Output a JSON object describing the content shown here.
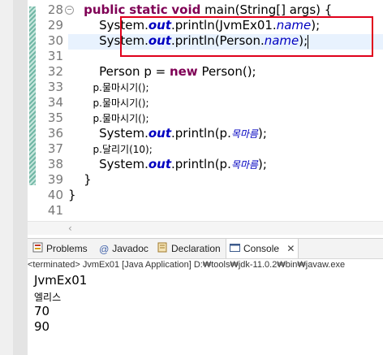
{
  "editor": {
    "lines": [
      {
        "num": "28",
        "parts": [
          {
            "t": "    "
          },
          {
            "t": "public",
            "c": "kw"
          },
          {
            "t": " "
          },
          {
            "t": "static",
            "c": "kw"
          },
          {
            "t": " "
          },
          {
            "t": "void",
            "c": "kw"
          },
          {
            "t": " main(String[] args) {"
          }
        ]
      },
      {
        "num": "29",
        "parts": [
          {
            "t": "        System."
          },
          {
            "t": "out",
            "c": "sfld"
          },
          {
            "t": ".println(JvmEx01."
          },
          {
            "t": "name",
            "c": "fld"
          },
          {
            "t": ");"
          }
        ]
      },
      {
        "num": "30",
        "parts": [
          {
            "t": "        System."
          },
          {
            "t": "out",
            "c": "sfld"
          },
          {
            "t": ".println(Person."
          },
          {
            "t": "name",
            "c": "fld"
          },
          {
            "t": ");"
          }
        ]
      },
      {
        "num": "31",
        "parts": [
          {
            "t": ""
          }
        ]
      },
      {
        "num": "32",
        "parts": [
          {
            "t": "        Person p = "
          },
          {
            "t": "new",
            "c": "kw"
          },
          {
            "t": " Person();"
          }
        ]
      },
      {
        "num": "33",
        "parts": [
          {
            "t": "        p.물마시기();"
          }
        ]
      },
      {
        "num": "34",
        "parts": [
          {
            "t": "        p.물마시기();"
          }
        ]
      },
      {
        "num": "35",
        "parts": [
          {
            "t": "        p.물마시기();"
          }
        ]
      },
      {
        "num": "36",
        "parts": [
          {
            "t": "        System."
          },
          {
            "t": "out",
            "c": "sfld"
          },
          {
            "t": ".println(p."
          },
          {
            "t": "목마름",
            "c": "fld"
          },
          {
            "t": ");"
          }
        ]
      },
      {
        "num": "37",
        "parts": [
          {
            "t": "        p.달리기(10);"
          }
        ]
      },
      {
        "num": "38",
        "parts": [
          {
            "t": "        System."
          },
          {
            "t": "out",
            "c": "sfld"
          },
          {
            "t": ".println(p."
          },
          {
            "t": "목마름",
            "c": "fld"
          },
          {
            "t": ");"
          }
        ]
      },
      {
        "num": "39",
        "parts": [
          {
            "t": "    }"
          }
        ]
      },
      {
        "num": "40",
        "parts": [
          {
            "t": "}"
          }
        ]
      },
      {
        "num": "41",
        "parts": [
          {
            "t": ""
          }
        ]
      }
    ]
  },
  "tabs": [
    {
      "label": "Problems",
      "icon": "problems-icon"
    },
    {
      "label": "Javadoc",
      "icon": "at-icon"
    },
    {
      "label": "Declaration",
      "icon": "declaration-icon"
    },
    {
      "label": "Console",
      "icon": "console-icon"
    }
  ],
  "status_text": "<terminated> JvmEx01 [Java Application] D:₩tools₩jdk-11.0.2₩bin₩javaw.exe",
  "console_output": [
    "JvmEx01",
    "엘리스",
    "70",
    "90"
  ],
  "colors": {
    "keyword": "#7f0055",
    "field": "#0000c0",
    "highlight_box": "#e0001b"
  }
}
